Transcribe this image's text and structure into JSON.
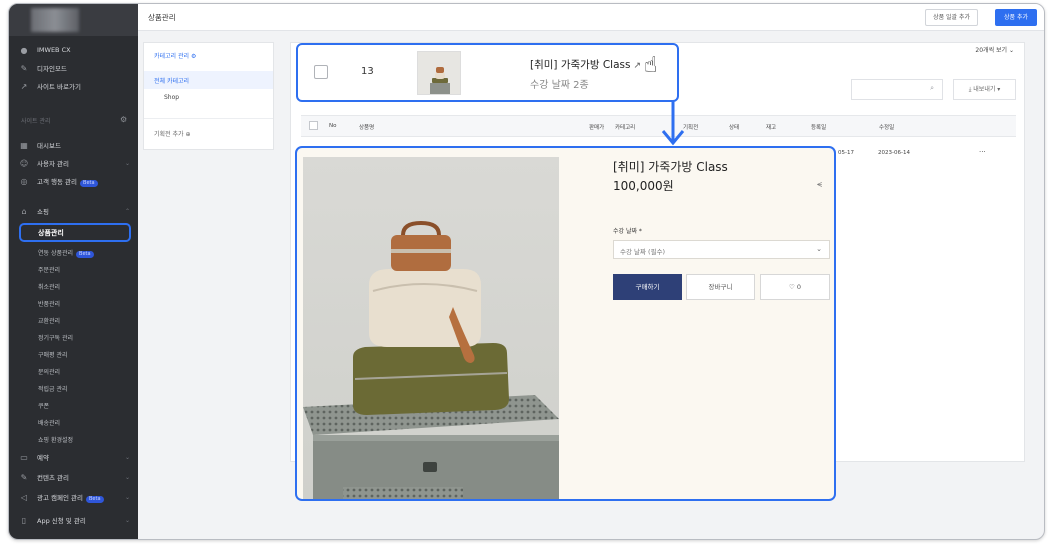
{
  "header": {
    "title": "상품관리",
    "bulk_add_label": "상품 일괄 추가",
    "add_label": "상품 추가"
  },
  "sidebar": {
    "site_name": "IMWEB CX",
    "design_mode": "디자인모드",
    "site_shortcut": "사이트 바로가기",
    "section_label": "사이트 관리",
    "dashboard": "대시보드",
    "user_manage": "사용자 관리",
    "customer_behavior": "고객 행동 관리",
    "beta": "Beta",
    "shopping": "쇼핑",
    "product_manage": "상품관리",
    "linked_product_manage": "연동 상품관리",
    "shopping_sub": [
      "주문관리",
      "취소관리",
      "반품관리",
      "교환관리",
      "정기구독 관리",
      "구매평 관리",
      "문의관리",
      "적립금 관리",
      "쿠폰",
      "배송관리",
      "쇼핑 환경설정"
    ],
    "reservation": "예약",
    "content_manage": "컨텐츠 관리",
    "ad_campaign": "광고 캠페인 관리",
    "app_apply": "App 신청 및 관리"
  },
  "category": {
    "title": "카테고리 관리",
    "all": "전체 카테고리",
    "shop": "Shop",
    "plan_add": "기획전 추가"
  },
  "list": {
    "per_page": "20개씩 보기",
    "export_label": "내보내기",
    "columns": [
      "No",
      "상품명",
      "판매가",
      "카테고리",
      "기획전",
      "상태",
      "재고",
      "등록일",
      "수정일"
    ],
    "row_reg_partial": "05-17",
    "row_mod": "2023-06-14",
    "row_more": "···"
  },
  "zoom_row": {
    "no": "13",
    "name": "[취미] 가죽가방 Class",
    "subtitle": "수강 날짜 2종"
  },
  "detail": {
    "name": "[취미] 가죽가방 Class",
    "price": "100,000원",
    "option_label": "수강 날짜 *",
    "option_placeholder": "수강 날짜 (필수)",
    "buy_label": "구매하기",
    "cart_label": "장바구니",
    "like_label": "♡ 0"
  },
  "colors": {
    "accent": "#2e6ff0",
    "sidebar_bg": "#2b2d31",
    "buy_button": "#2e4077"
  }
}
